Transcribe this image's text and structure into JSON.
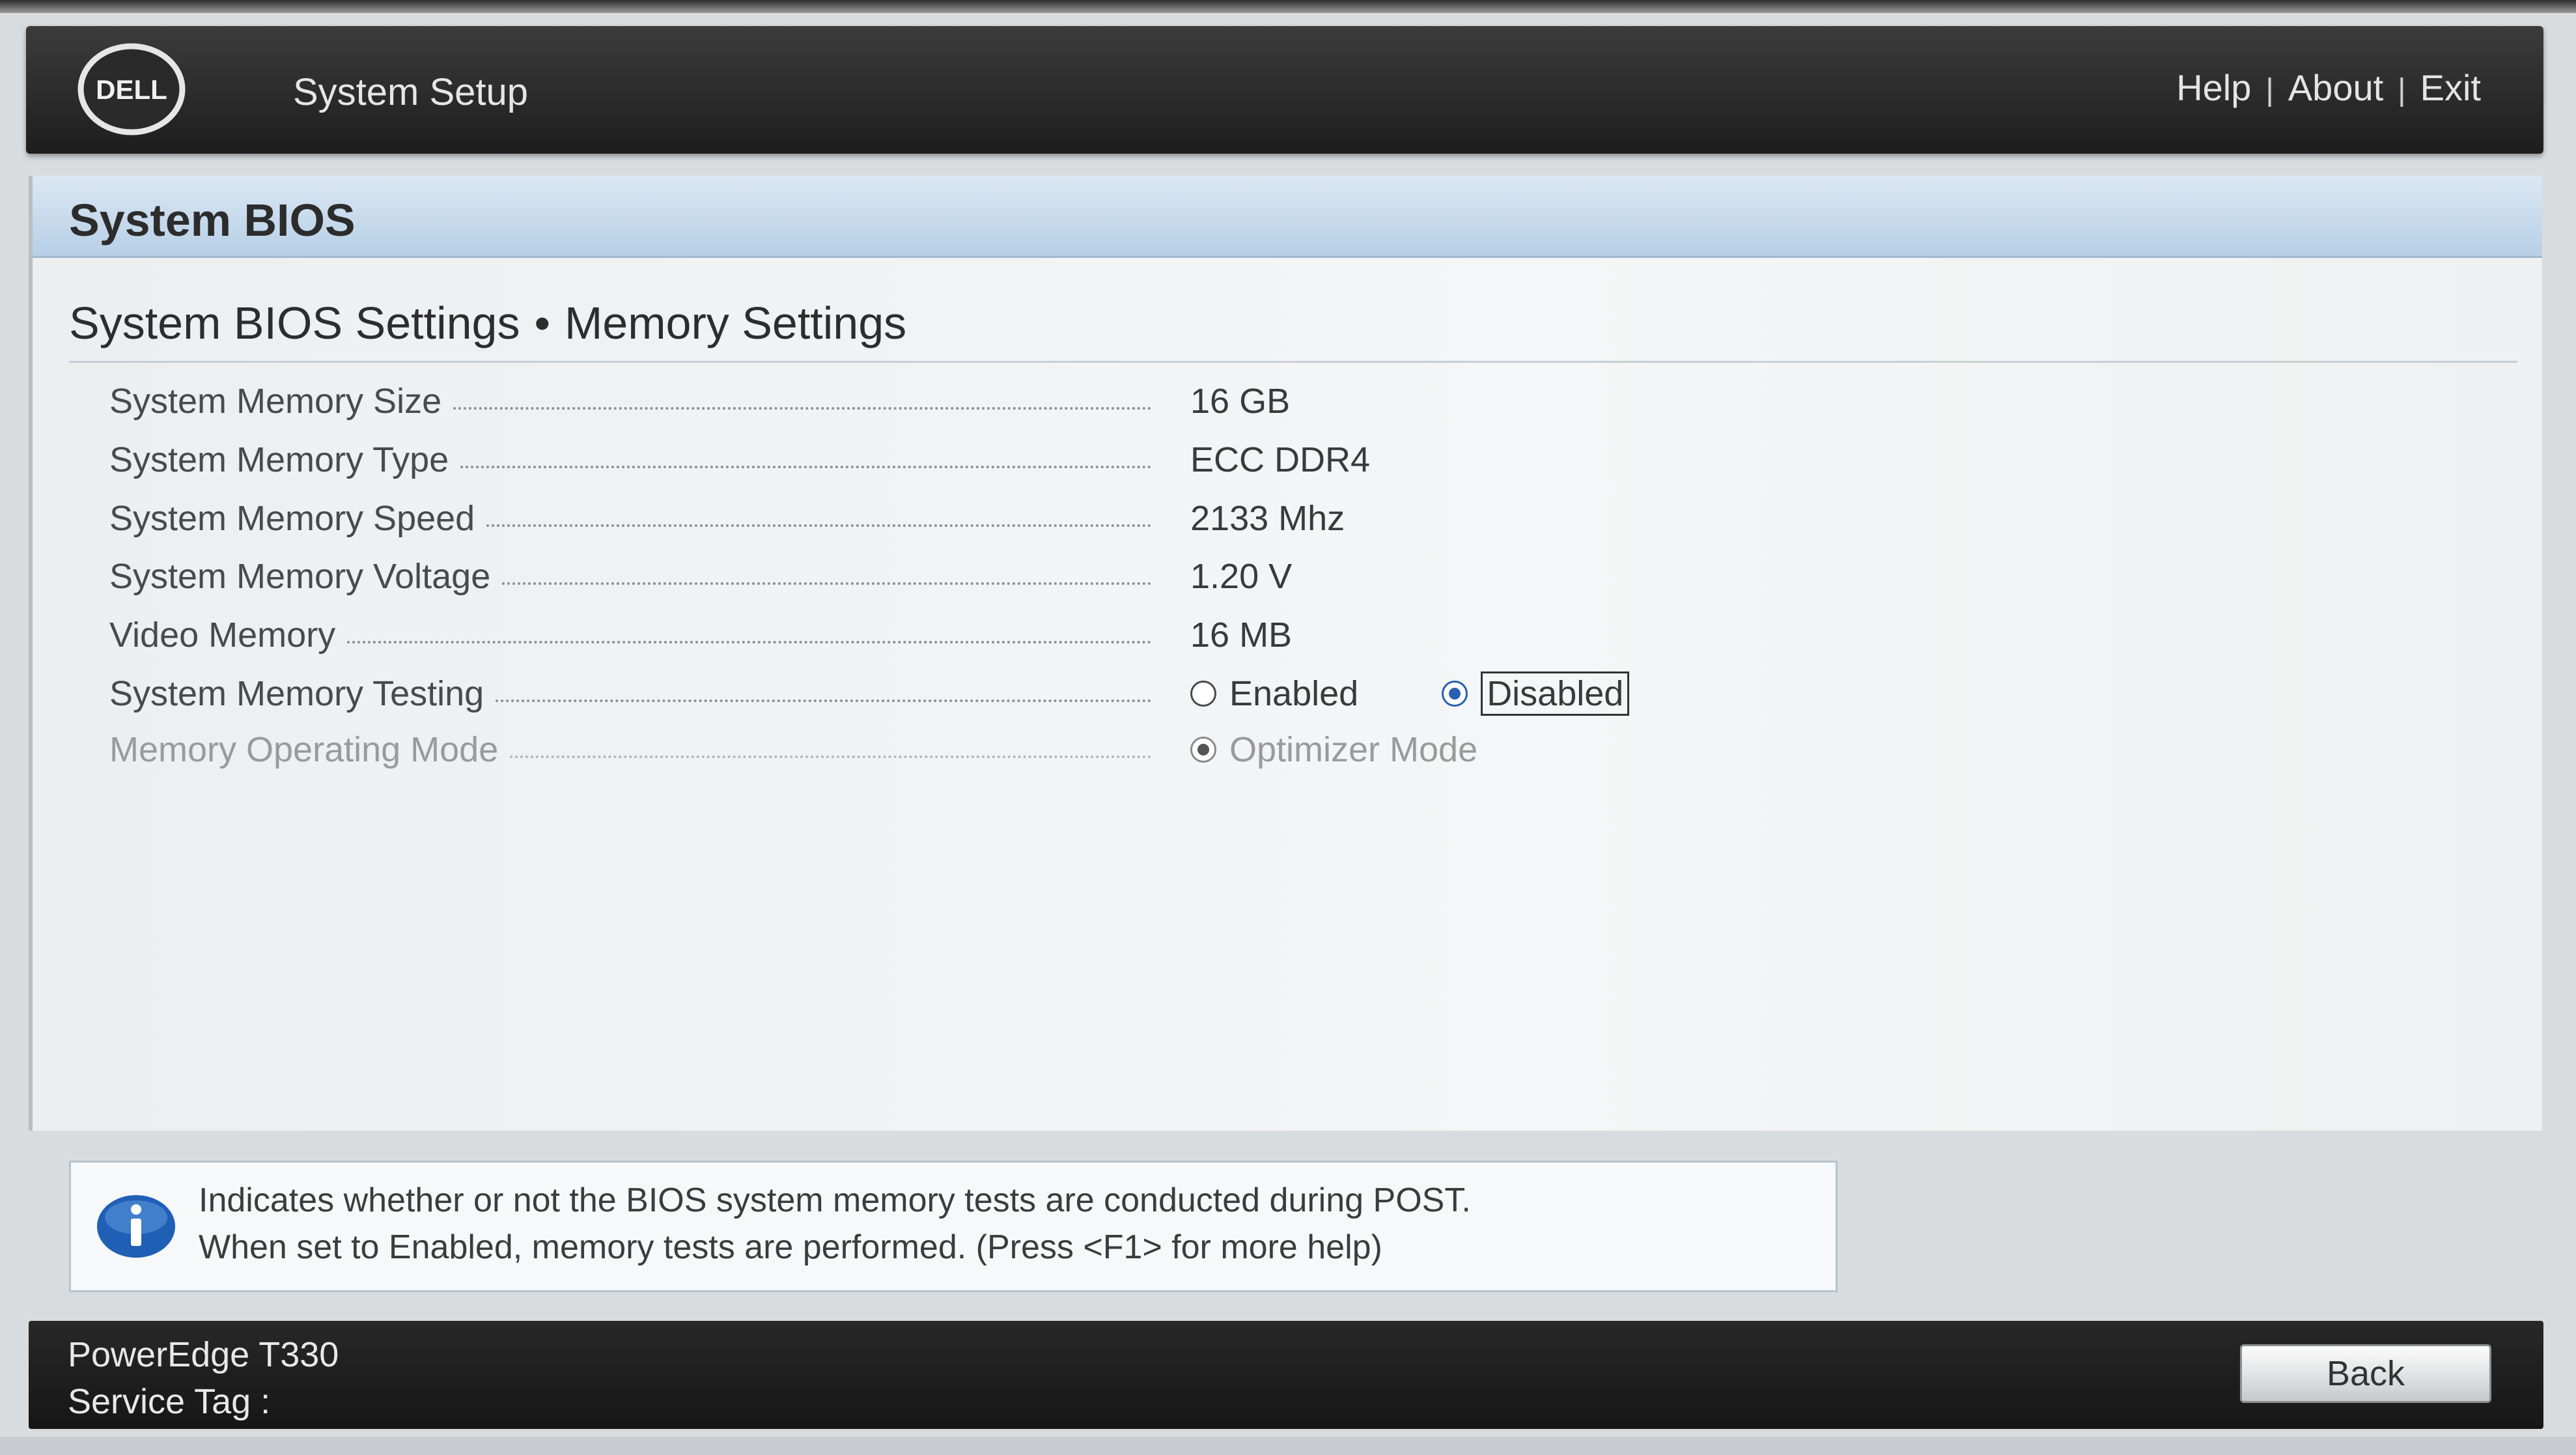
{
  "header": {
    "logo_text": "DELL",
    "app_title": "System Setup",
    "links": [
      "Help",
      "About",
      "Exit"
    ],
    "link_separator": "|"
  },
  "panel": {
    "title": "System BIOS",
    "breadcrumb": [
      "System BIOS Settings",
      "Memory Settings"
    ],
    "breadcrumb_separator": "•"
  },
  "settings": [
    {
      "label": "System Memory Size",
      "value": "16 GB"
    },
    {
      "label": "System Memory Type",
      "value": "ECC DDR4"
    },
    {
      "label": "System Memory Speed",
      "value": "2133 Mhz"
    },
    {
      "label": "System Memory Voltage",
      "value": "1.20 V"
    },
    {
      "label": "Video Memory",
      "value": "16 MB"
    },
    {
      "label": "System Memory Testing",
      "options": [
        "Enabled",
        "Disabled"
      ],
      "selected": "Disabled"
    },
    {
      "label": "Memory Operating Mode",
      "options": [
        "Optimizer Mode"
      ],
      "selected": "Optimizer Mode",
      "disabled": true
    }
  ],
  "info": {
    "icon": "info-icon",
    "line1": "Indicates whether or not the BIOS system memory tests are conducted during POST.",
    "line2": "When set to Enabled, memory tests are performed. (Press <F1> for more help)"
  },
  "footer": {
    "model": "PowerEdge T330",
    "service_tag_label": "Service Tag :",
    "back_label": "Back"
  },
  "colors": {
    "header_bg": "#1d1d1d",
    "panel_header_bg": "#b7cfe6",
    "radio_selected": "#2a5fb0",
    "footer_bg": "#161616"
  }
}
